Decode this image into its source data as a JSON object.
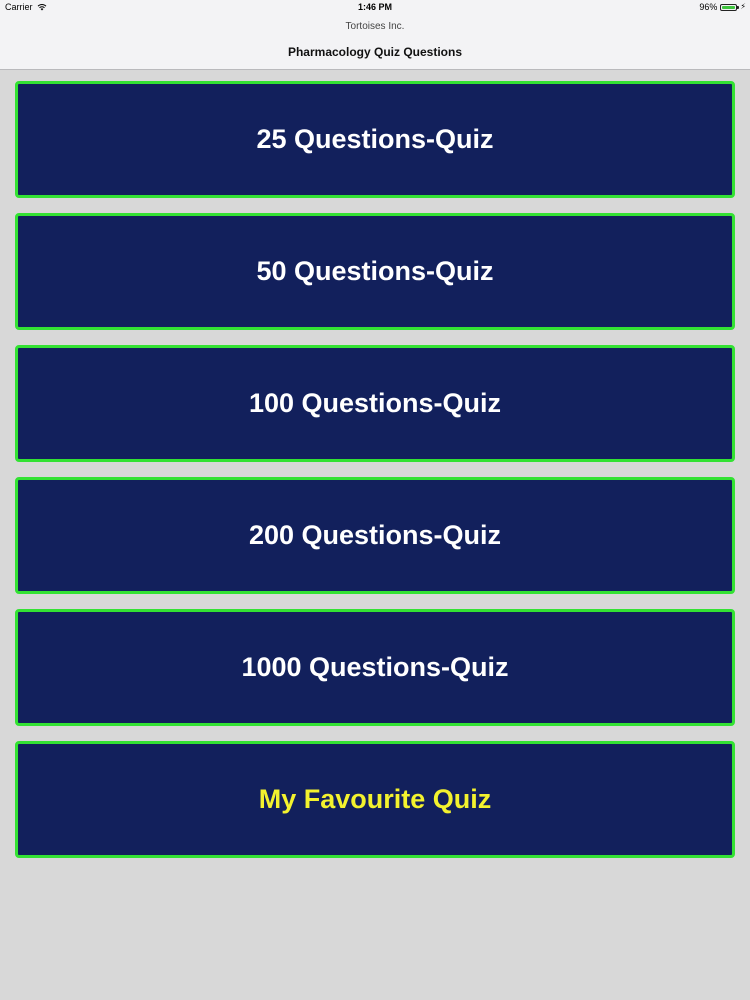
{
  "status_bar": {
    "carrier": "Carrier",
    "wifi_icon": "wifi-icon",
    "time": "1:46 PM",
    "battery_percent": "96%",
    "battery_level": 0.96,
    "battery_icon": "battery-icon",
    "charging_icon": "charging-bolt-icon"
  },
  "header": {
    "prompt": "Tortoises Inc.",
    "title": "Pharmacology Quiz Questions"
  },
  "quizzes": [
    {
      "label": "25 Questions-Quiz"
    },
    {
      "label": "50 Questions-Quiz"
    },
    {
      "label": "100 Questions-Quiz"
    },
    {
      "label": "200 Questions-Quiz"
    },
    {
      "label": "1000 Questions-Quiz"
    },
    {
      "label": "My Favourite Quiz"
    }
  ],
  "colors": {
    "background": "#d8d8d8",
    "button_fill": "#12205c",
    "button_border": "#33e233",
    "button_text": "#ffffff",
    "favourite_text": "#f3f22e",
    "battery_fill": "#3ec43e"
  }
}
